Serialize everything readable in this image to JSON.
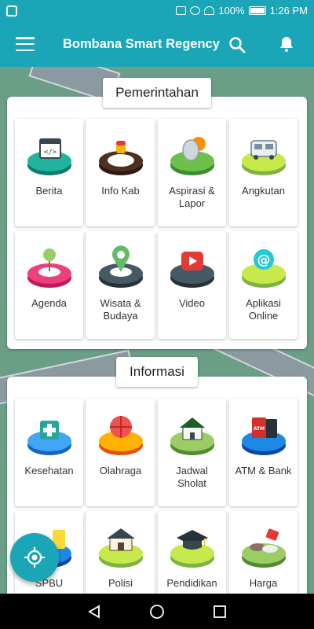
{
  "status_bar": {
    "battery": "100%",
    "time": "1:26 PM"
  },
  "app_bar": {
    "title": "Bombana Smart Regency"
  },
  "sections": [
    {
      "title": "Pemerintahan",
      "items": [
        {
          "label": "Berita",
          "icon": "code-window-icon"
        },
        {
          "label": "Info Kab",
          "icon": "info-cup-icon"
        },
        {
          "label": "Aspirasi & Lapor",
          "icon": "satellite-dish-icon"
        },
        {
          "label": "Angkutan",
          "icon": "truck-icon"
        },
        {
          "label": "Agenda",
          "icon": "pushpin-icon"
        },
        {
          "label": "Wisata & Budaya",
          "icon": "location-heart-icon"
        },
        {
          "label": "Video",
          "icon": "video-play-icon"
        },
        {
          "label": "Aplikasi Online",
          "icon": "at-sign-icon"
        }
      ]
    },
    {
      "title": "Informasi",
      "items": [
        {
          "label": "Kesehatan",
          "icon": "health-cross-icon"
        },
        {
          "label": "Olahraga",
          "icon": "basketball-icon"
        },
        {
          "label": "Jadwal Sholat",
          "icon": "mosque-icon"
        },
        {
          "label": "ATM & Bank",
          "icon": "atm-icon"
        },
        {
          "label": "SPBU",
          "icon": "fuel-icon"
        },
        {
          "label": "Polisi",
          "icon": "police-building-icon"
        },
        {
          "label": "Pendidikan",
          "icon": "graduation-cap-icon"
        },
        {
          "label": "Harga",
          "icon": "price-tag-icon"
        }
      ]
    }
  ]
}
